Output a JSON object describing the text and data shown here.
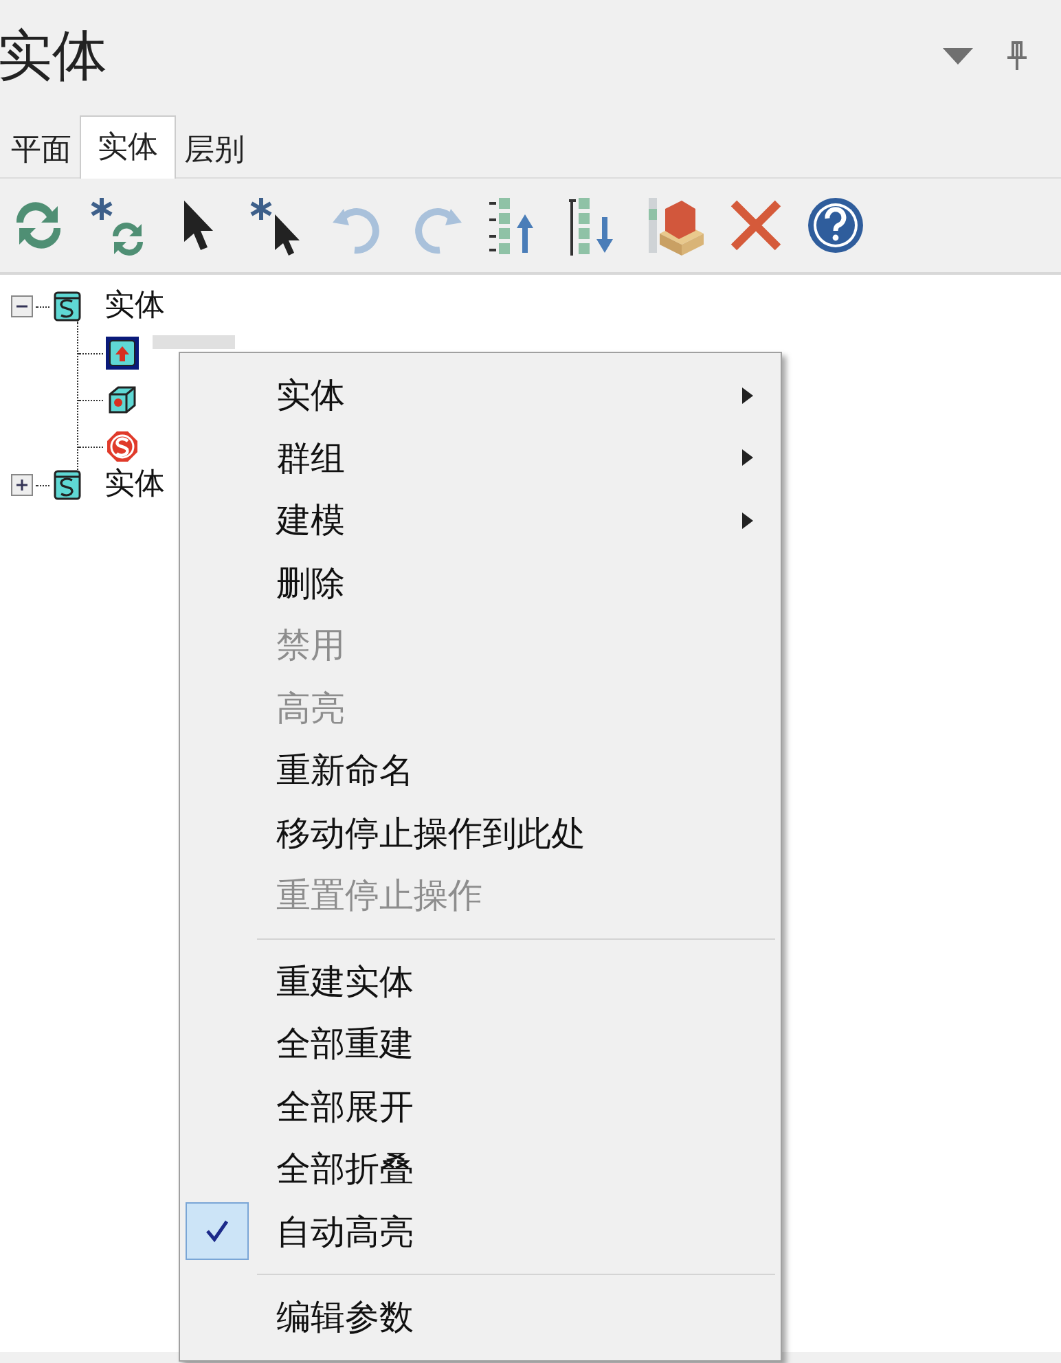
{
  "panel": {
    "title": "实体"
  },
  "tabs": [
    {
      "label": "平面",
      "selected": false
    },
    {
      "label": "实体",
      "selected": true
    },
    {
      "label": "层别",
      "selected": false
    }
  ],
  "toolbar": [
    {
      "kind": "regen",
      "disabled": false
    },
    {
      "kind": "regen-all",
      "disabled": false
    },
    {
      "kind": "select",
      "disabled": false
    },
    {
      "kind": "select-all",
      "disabled": false
    },
    {
      "kind": "undo",
      "disabled": true
    },
    {
      "kind": "redo",
      "disabled": true
    },
    {
      "kind": "move-up",
      "disabled": false
    },
    {
      "kind": "move-down",
      "disabled": false
    },
    {
      "kind": "solid",
      "disabled": false
    },
    {
      "kind": "delete",
      "disabled": false
    },
    {
      "kind": "help",
      "disabled": false
    }
  ],
  "tree": [
    {
      "label": "实体",
      "expanded": true,
      "children": [
        {
          "kind": "extrude",
          "selected": true
        },
        {
          "kind": "hole",
          "selected": false
        },
        {
          "kind": "stop",
          "selected": false
        }
      ]
    },
    {
      "label": "实体",
      "expanded": false
    }
  ],
  "context_menu": {
    "groups": [
      [
        {
          "label": "实体",
          "submenu": true,
          "disabled": false,
          "checked": false
        },
        {
          "label": "群组",
          "submenu": true,
          "disabled": false,
          "checked": false
        },
        {
          "label": "建模",
          "submenu": true,
          "disabled": false,
          "checked": false
        },
        {
          "label": "删除",
          "submenu": false,
          "disabled": false,
          "checked": false
        },
        {
          "label": "禁用",
          "submenu": false,
          "disabled": true,
          "checked": false
        },
        {
          "label": "高亮",
          "submenu": false,
          "disabled": true,
          "checked": false
        },
        {
          "label": "重新命名",
          "submenu": false,
          "disabled": false,
          "checked": false
        },
        {
          "label": "移动停止操作到此处",
          "submenu": false,
          "disabled": false,
          "checked": false
        },
        {
          "label": "重置停止操作",
          "submenu": false,
          "disabled": true,
          "checked": false
        }
      ],
      [
        {
          "label": "重建实体",
          "submenu": false,
          "disabled": false,
          "checked": false
        },
        {
          "label": "全部重建",
          "submenu": false,
          "disabled": false,
          "checked": false
        },
        {
          "label": "全部展开",
          "submenu": false,
          "disabled": false,
          "checked": false
        },
        {
          "label": "全部折叠",
          "submenu": false,
          "disabled": false,
          "checked": false
        },
        {
          "label": "自动高亮",
          "submenu": false,
          "disabled": false,
          "checked": true
        }
      ],
      [
        {
          "label": "编辑参数",
          "submenu": false,
          "disabled": false,
          "checked": false
        }
      ]
    ]
  }
}
